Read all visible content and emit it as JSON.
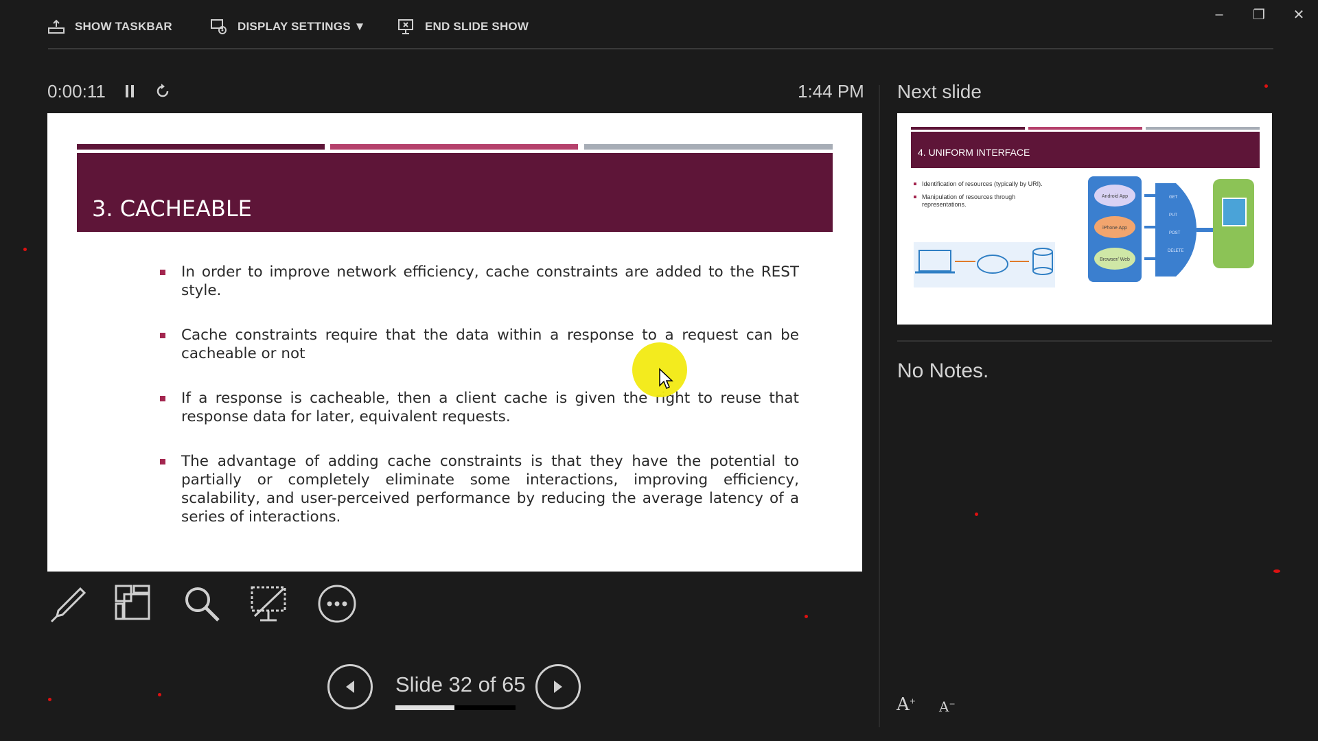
{
  "toolbar": {
    "show_taskbar": "SHOW TASKBAR",
    "display_settings": "DISPLAY SETTINGS ▼",
    "end_slide_show": "END SLIDE SHOW"
  },
  "window_controls": {
    "minimize": "–",
    "restore": "❐",
    "close": "✕"
  },
  "presenter": {
    "elapsed": "0:00:11",
    "pause_icon": "pause-icon",
    "restart_icon": "restart-icon",
    "clock": "1:44 PM"
  },
  "current_slide": {
    "title": "3. CACHEABLE",
    "bullets": [
      "In order to improve network efficiency, cache constraints are added to the REST style.",
      "Cache constraints require that the data within a response to a request can be cacheable or not",
      "If a response is cacheable, then a client cache is given the right to reuse that response data for later, equivalent requests.",
      "The advantage of adding cache constraints is that they have the potential to partially or completely eliminate some interactions, improving efficiency, scalability, and user-perceived performance by reducing the average latency of a series of interactions."
    ],
    "header_bar_colors": [
      "#5e1538",
      "#b5416c",
      "#a7adb6"
    ]
  },
  "tools": [
    "pen-icon",
    "see-all-slides-icon",
    "zoom-icon",
    "black-screen-icon",
    "more-options-icon"
  ],
  "navigation": {
    "label": "Slide 32 of 65",
    "progress_fraction": 0.49
  },
  "next_slide": {
    "label": "Next slide",
    "title": "4. UNIFORM INTERFACE",
    "bullets": [
      "Identification of resources (typically by URI).",
      "Manipulation of resources through representations."
    ],
    "diagram_labels": [
      "Android App",
      "iPhone App",
      "Browser/ Web",
      "GET",
      "PUT",
      "POST",
      "DELETE"
    ]
  },
  "notes": {
    "text": "No Notes."
  },
  "font_controls": {
    "increase": "A",
    "decrease": "A"
  },
  "colors": {
    "background": "#1b1b1b",
    "accent": "#5e1538",
    "pointer": "#f2ea12"
  }
}
